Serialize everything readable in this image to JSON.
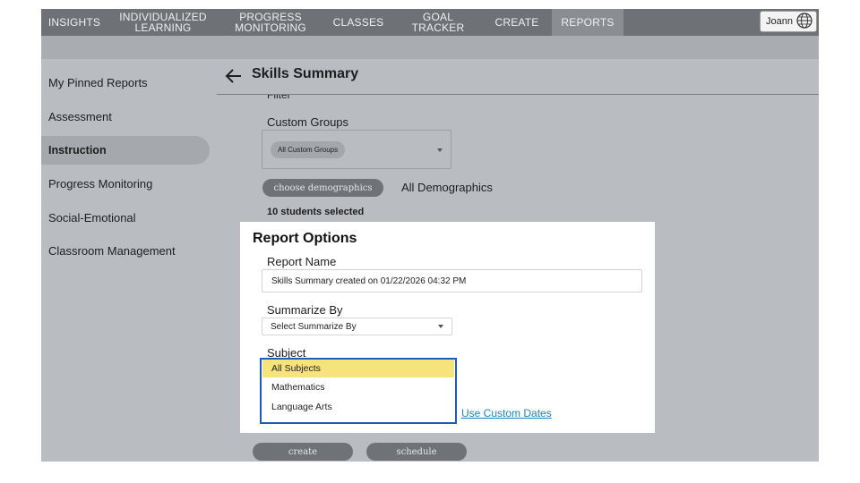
{
  "nav": {
    "items": [
      {
        "label": "INSIGHTS"
      },
      {
        "label": "INDIVIDUALIZED\nLEARNING"
      },
      {
        "label": "PROGRESS\nMONITORING"
      },
      {
        "label": "CLASSES"
      },
      {
        "label": "GOAL TRACKER"
      },
      {
        "label": "CREATE"
      },
      {
        "label": "REPORTS"
      }
    ],
    "active": "REPORTS",
    "user_name": "Joann",
    "user_icon": "globe-icon"
  },
  "sidebar": {
    "items": [
      {
        "label": "My Pinned Reports"
      },
      {
        "label": "Assessment"
      },
      {
        "label": "Instruction"
      },
      {
        "label": "Progress Monitoring"
      },
      {
        "label": "Social-Emotional"
      },
      {
        "label": "Classroom Management"
      }
    ],
    "active": "Instruction"
  },
  "page": {
    "title": "Skills Summary",
    "back_icon": "back-arrow-icon",
    "cut_label": "Filter"
  },
  "filters": {
    "custom_groups_label": "Custom Groups",
    "custom_groups_chip": "All Custom Groups",
    "choose_demographics_label": "choose demographics",
    "demographics_value": "All Demographics",
    "students_selected": "10 students selected"
  },
  "report_options": {
    "title": "Report Options",
    "report_name_label": "Report Name",
    "report_name_value": "Skills Summary created on 01/22/2026 04:32 PM",
    "summarize_by_label": "Summarize By",
    "summarize_by_placeholder": "Select Summarize By",
    "subject_label": "Subject",
    "subject_options": [
      {
        "label": "All Subjects"
      },
      {
        "label": "Mathematics"
      },
      {
        "label": "Language Arts"
      }
    ],
    "subject_selected": "All Subjects",
    "custom_dates_link": "Use Custom Dates"
  },
  "actions": {
    "create_label": "create",
    "schedule_label": "schedule"
  },
  "colors": {
    "nav_bg": "#6e7176",
    "overlay_bg": "#b9bcc1",
    "highlight": "#f6e37b",
    "dropdown_border": "#1a5fb4",
    "link": "#1a86c8"
  }
}
